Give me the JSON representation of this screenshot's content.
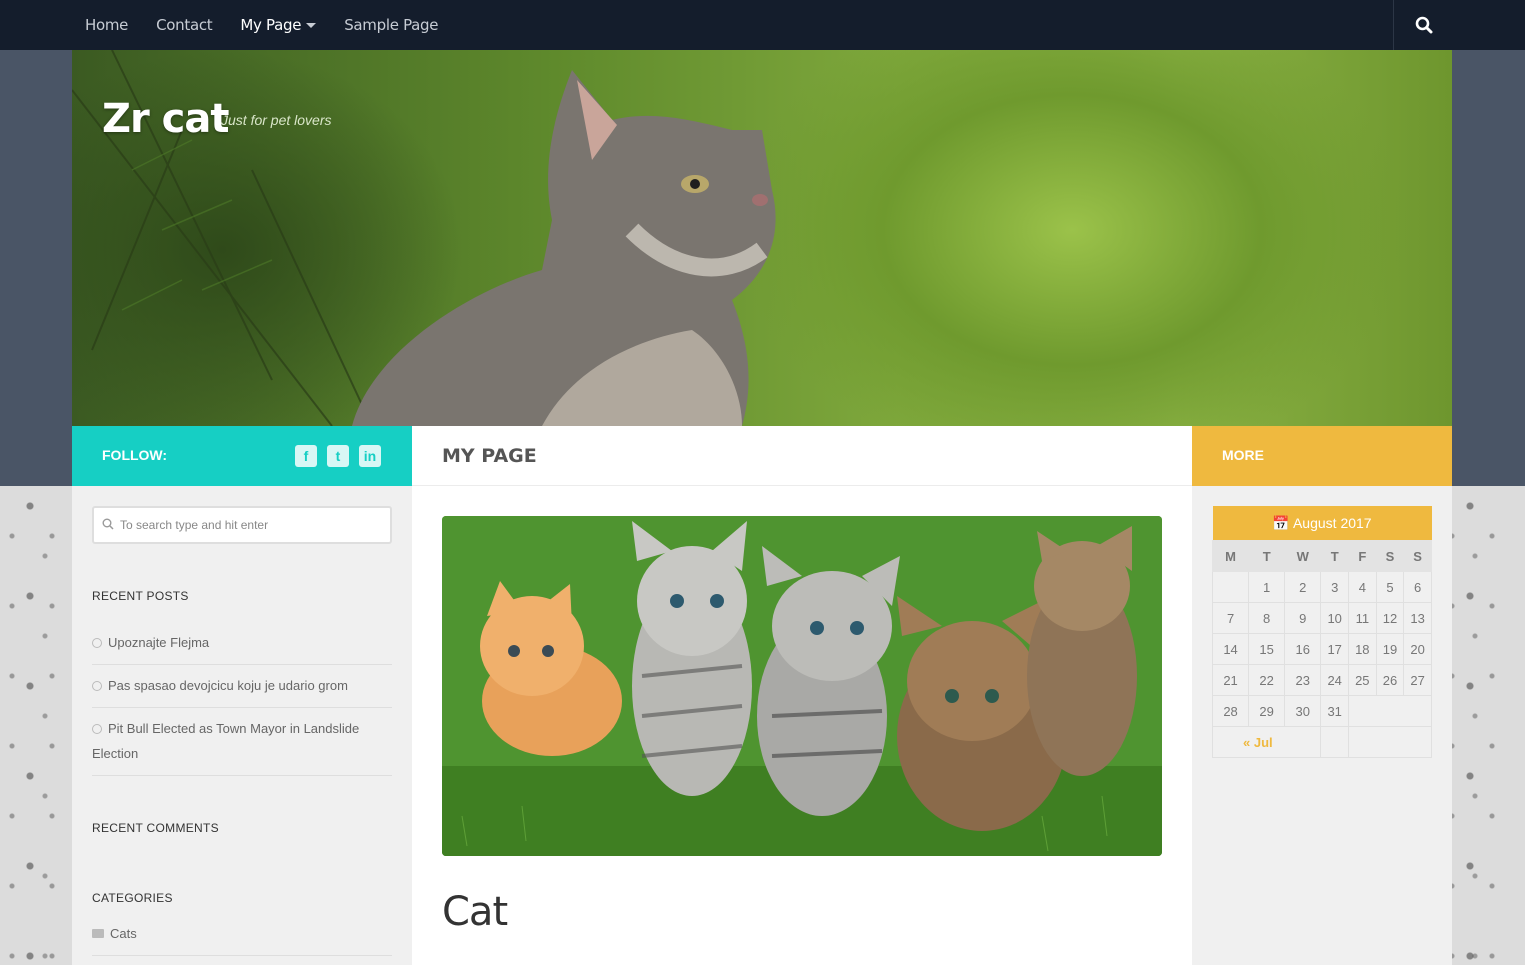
{
  "nav": {
    "items": [
      {
        "label": "Home"
      },
      {
        "label": "Contact"
      },
      {
        "label": "My Page"
      },
      {
        "label": "Sample Page"
      }
    ]
  },
  "site": {
    "title": "Zr cat",
    "tagline": "Just for pet lovers"
  },
  "follow": {
    "label": "FOLLOW:",
    "icons": [
      "facebook-icon",
      "twitter-icon",
      "linkedin-icon"
    ]
  },
  "page_header": "MY PAGE",
  "more_label": "MORE",
  "search": {
    "placeholder": "To search type and hit enter"
  },
  "sidebar": {
    "recent_posts_title": "RECENT POSTS",
    "recent_posts": [
      "Upoznajte Flejma",
      "Pas spasao devojcicu koju je udario grom",
      "Pit Bull Elected as Town Mayor in Landslide Election"
    ],
    "recent_comments_title": "RECENT COMMENTS",
    "categories_title": "CATEGORIES",
    "categories": [
      "Cats"
    ]
  },
  "post": {
    "title": "Cat"
  },
  "calendar": {
    "caption": "August 2017",
    "headers": [
      "M",
      "T",
      "W",
      "T",
      "F",
      "S",
      "S"
    ],
    "rows": [
      [
        "",
        "1",
        "2",
        "3",
        "4",
        "5",
        "6"
      ],
      [
        "7",
        "8",
        "9",
        "10",
        "11",
        "12",
        "13"
      ],
      [
        "14",
        "15",
        "16",
        "17",
        "18",
        "19",
        "20"
      ],
      [
        "21",
        "22",
        "23",
        "24",
        "25",
        "26",
        "27"
      ],
      [
        "28",
        "29",
        "30",
        "31",
        "",
        "",
        ""
      ]
    ],
    "prev_link": "« Jul"
  },
  "colors": {
    "teal": "#16cfc4",
    "amber": "#efb93f",
    "nav_bg": "#141d2c"
  }
}
